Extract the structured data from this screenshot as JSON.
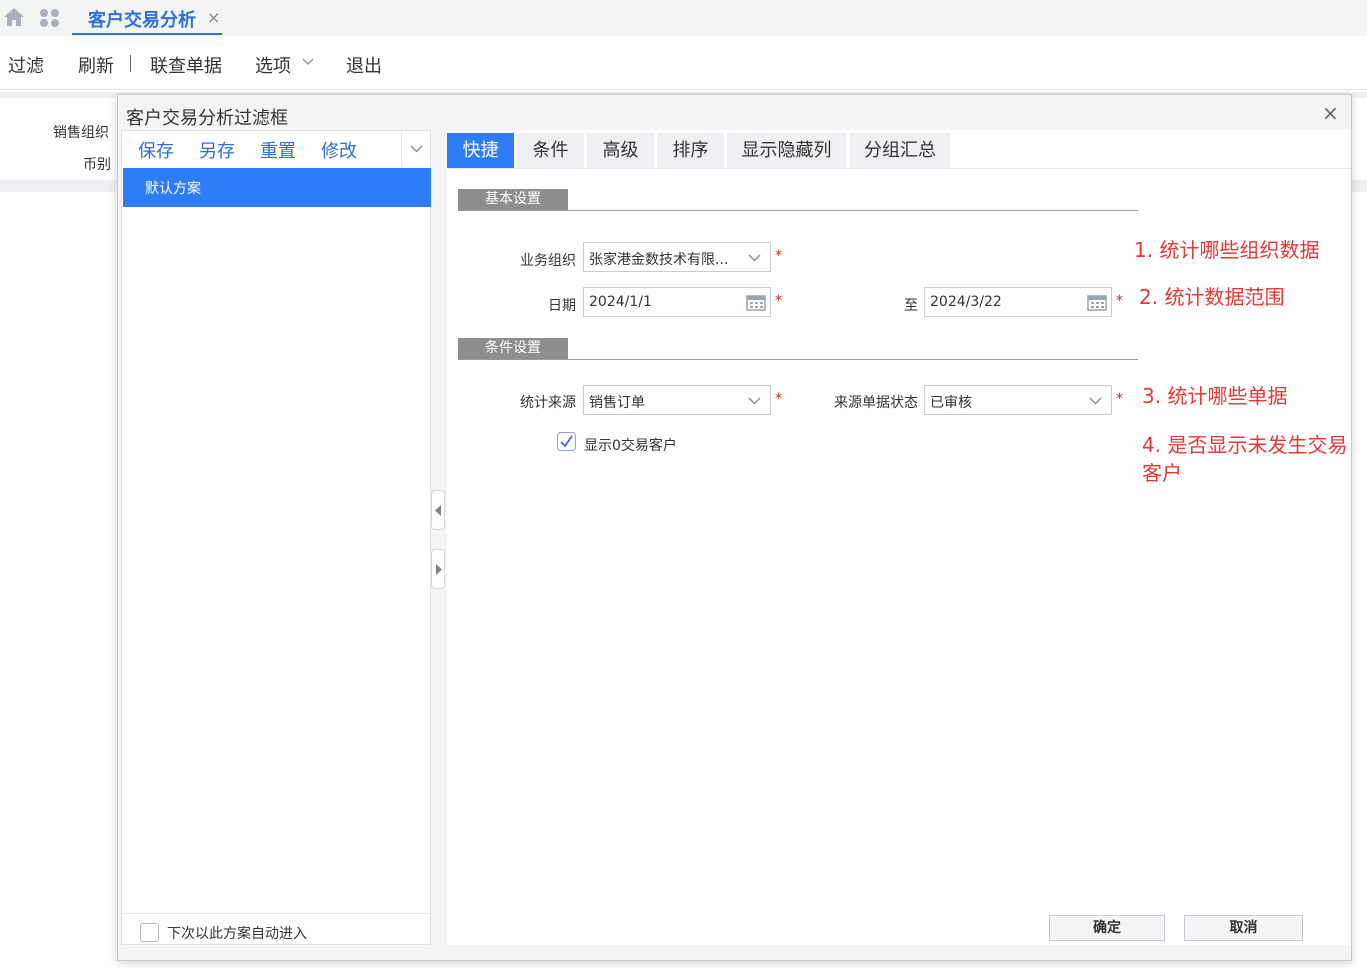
{
  "tabbar": {
    "page_tab_label": "客户交易分析",
    "close_glyph": "×"
  },
  "toolbar": {
    "filter": "过滤",
    "refresh": "刷新",
    "linked_docs": "联查单据",
    "options": "选项",
    "exit": "退出"
  },
  "background_form": {
    "sales_org_label": "销售组织",
    "currency_label": "币别"
  },
  "dialog": {
    "title": "客户交易分析过滤框",
    "close_glyph": "×",
    "scheme": {
      "save": "保存",
      "save_as": "另存",
      "reset": "重置",
      "modify": "修改",
      "default_scheme": "默认方案",
      "auto_enter_label": "下次以此方案自动进入"
    },
    "tabs": [
      "快捷",
      "条件",
      "高级",
      "排序",
      "显示隐藏列",
      "分组汇总"
    ],
    "basic_section": "基本设置",
    "condition_section": "条件设置",
    "fields": {
      "org_label": "业务组织",
      "org_value": "张家港金数技术有限...",
      "date_label": "日期",
      "date_from": "2024/1/1",
      "to_label": "至",
      "date_to": "2024/3/22",
      "source_label": "统计来源",
      "source_value": "销售订单",
      "status_label": "来源单据状态",
      "status_value": "已审核",
      "zero_label": "显示0交易客户",
      "zero_checked": true,
      "required_mark": "*"
    },
    "buttons": {
      "ok": "确定",
      "cancel": "取消"
    }
  },
  "annotations": {
    "a1": "1. 统计哪些组织数据",
    "a2": "2. 统计数据范围",
    "a3": "3. 统计哪些单据",
    "a4_line1": "4. 是否显示未发生交易",
    "a4_line2": "客户"
  },
  "colors": {
    "accent": "#2f7df6",
    "link": "#2f6fd8",
    "annotation": "#e53935",
    "required": "#e0201f",
    "section": "#8e8e8e"
  }
}
